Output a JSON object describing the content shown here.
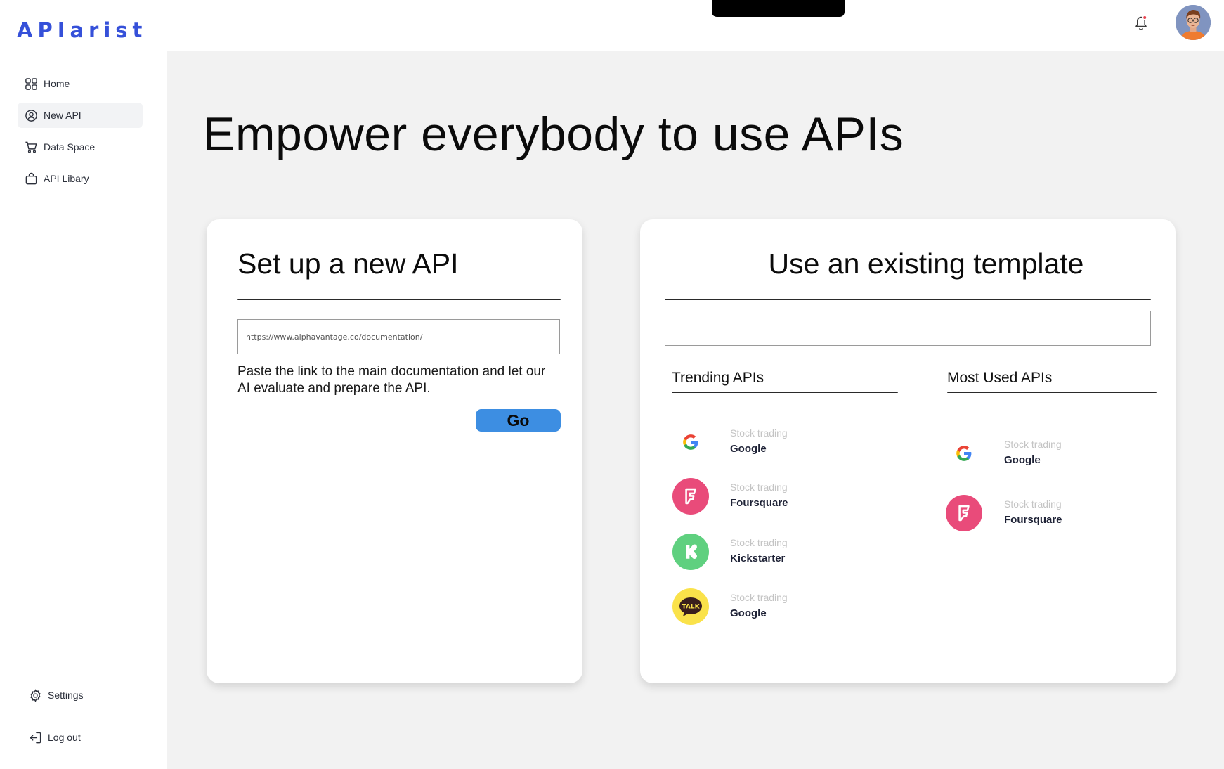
{
  "app": {
    "logo_text": "APIarist"
  },
  "sidebar": {
    "items": [
      {
        "label": "Home",
        "icon": "grid-icon"
      },
      {
        "label": "New API",
        "icon": "user-circle-icon",
        "active": true
      },
      {
        "label": "Data Space",
        "icon": "cart-icon"
      },
      {
        "label": "API Libary",
        "icon": "bag-icon"
      }
    ],
    "settings_label": "Settings",
    "logout_label": "Log out"
  },
  "header": {
    "notification_icon": "bell-icon",
    "has_notification_dot": true
  },
  "main": {
    "hero_title": "Empower everybody to use APIs"
  },
  "setup_card": {
    "title": "Set up a new API",
    "url_placeholder": "https://www.alphavantage.co/documentation/",
    "helper_text": "Paste the link to the main documentation and let our AI evaluate and prepare the API.",
    "go_label": "Go"
  },
  "template_card": {
    "title": "Use an existing template",
    "search_value": "",
    "trending": {
      "title": "Trending APIs",
      "items": [
        {
          "category": "Stock trading",
          "name": "Google",
          "icon": "google-icon"
        },
        {
          "category": "Stock trading",
          "name": "Foursquare",
          "icon": "foursquare-icon"
        },
        {
          "category": "Stock trading",
          "name": "Kickstarter",
          "icon": "kickstarter-icon"
        },
        {
          "category": "Stock trading",
          "name": "Google",
          "icon": "kakaotalk-icon",
          "icon_text": "TALK"
        }
      ]
    },
    "most_used": {
      "title": "Most Used APIs",
      "items": [
        {
          "category": "Stock trading",
          "name": "Google",
          "icon": "google-icon"
        },
        {
          "category": "Stock trading",
          "name": "Foursquare",
          "icon": "foursquare-icon"
        }
      ]
    }
  },
  "colors": {
    "brand": "#3550d9",
    "go_button": "#3d8ee2",
    "foursquare": "#e94b7a",
    "kickstarter": "#5fd07f",
    "kakaotalk": "#fae24a",
    "page_bg": "#f2f2f2"
  }
}
